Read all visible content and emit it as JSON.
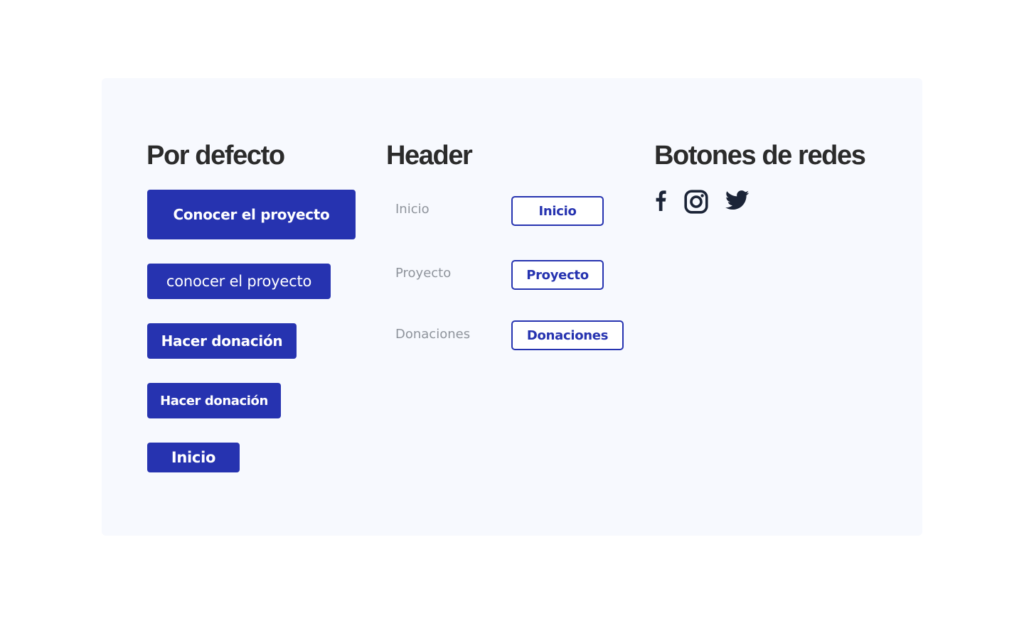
{
  "sections": {
    "default": {
      "title": "Por defecto",
      "buttons": [
        "Conocer el proyecto",
        "conocer el proyecto",
        "Hacer donación",
        "Hacer donación",
        "Inicio"
      ]
    },
    "header": {
      "title": "Header",
      "links": [
        "Inicio",
        "Proyecto",
        "Donaciones"
      ],
      "outline_buttons": [
        "Inicio",
        "Proyecto",
        "Donaciones"
      ]
    },
    "social": {
      "title": "Botones de redes",
      "icons": [
        "facebook-icon",
        "instagram-icon",
        "twitter-icon"
      ]
    }
  },
  "colors": {
    "primary": "#2633b0",
    "panel_background": "#f7f9fe",
    "heading": "#2b2b2b",
    "muted_link": "#8f949c",
    "icon": "#1b2437"
  }
}
